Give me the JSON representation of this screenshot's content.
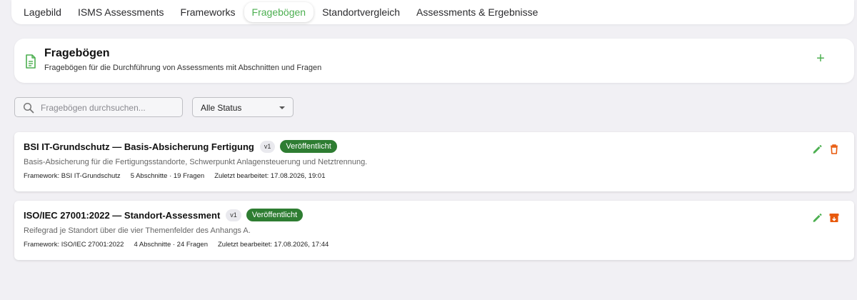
{
  "tabs": [
    {
      "label": "Lagebild"
    },
    {
      "label": "ISMS Assessments"
    },
    {
      "label": "Frameworks"
    },
    {
      "label": "Fragebögen"
    },
    {
      "label": "Standortvergleich"
    },
    {
      "label": "Assessments & Ergebnisse"
    }
  ],
  "active_tab": "Fragebögen",
  "header": {
    "title": "Fragebögen",
    "subtitle": "Fragebögen für die Durchführung von Assessments mit Abschnitten und Fragen",
    "add_label": "+",
    "icon": "document-icon"
  },
  "filters": {
    "search_placeholder": "Fragebögen durchsuchen...",
    "status_value": "Alle Status"
  },
  "questionnaires": [
    {
      "title": "BSI IT-Grundschutz — Basis-Absicherung Fertigung",
      "version": "v1",
      "status": "Veröffentlicht",
      "description": "Basis-Absicherung für die Fertigungsstandorte, Schwerpunkt Anlagensteuerung und Netztrennung.",
      "framework": "Framework: BSI IT-Grundschutz",
      "counts": "5 Abschnitte · 19 Fragen",
      "last_edited": "Zuletzt bearbeitet: 17.08.2026, 19:01",
      "actions": [
        "edit-icon",
        "trash-icon"
      ]
    },
    {
      "title": "ISO/IEC 27001:2022 — Standort-Assessment",
      "version": "v1",
      "status": "Veröffentlicht",
      "description": "Reifegrad je Standort über die vier Themenfelder des Anhangs A.",
      "framework": "Framework: ISO/IEC 27001:2022",
      "counts": "4 Abschnitte · 24 Fragen",
      "last_edited": "Zuletzt bearbeitet: 17.08.2026, 17:44",
      "actions": [
        "edit-icon",
        "archive-icon"
      ]
    }
  ],
  "colors": {
    "accent": "#4caf50",
    "status_published": "#2e7d32",
    "danger": "#e8590c",
    "background": "#f1f0f4"
  }
}
